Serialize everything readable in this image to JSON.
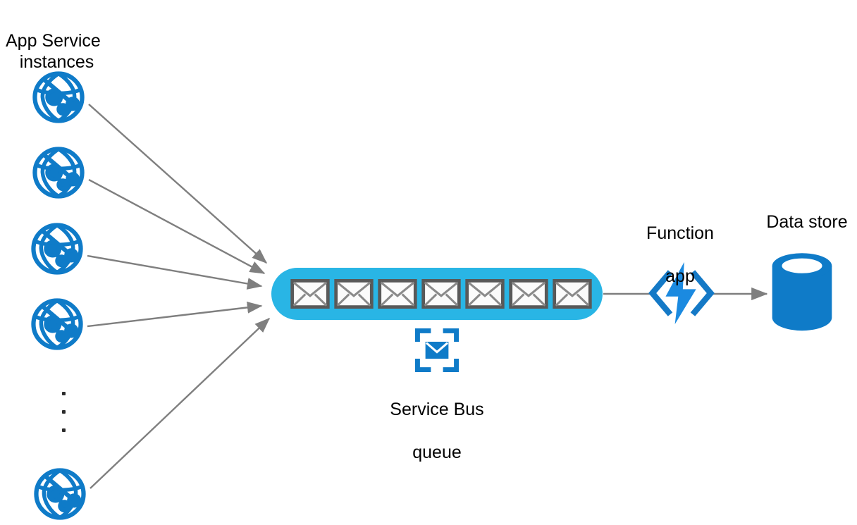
{
  "diagram": {
    "title": "Queue-based load leveling with App Service, Service Bus queue, Function app and Data store",
    "background_color": "#ffffff",
    "colors": {
      "azure_blue": "#0F7BC8",
      "queue_cyan": "#29B5E5",
      "arrow_gray": "#7F7F7F",
      "envelope_border": "#595959",
      "envelope_fill": "#FBFBFB",
      "text_black": "#000000"
    },
    "labels": {
      "app_service": "App Service instances",
      "app_service_line1": "App Service",
      "app_service_line2": "instances",
      "service_bus": "Service Bus queue",
      "service_bus_line1": "Service Bus",
      "service_bus_line2": "queue",
      "function_app": "Function app",
      "function_app_line1": "Function",
      "function_app_line2": "app",
      "data_store": "Data store"
    },
    "nodes": {
      "app_service_instances": {
        "icon": "app-service-globe-icon",
        "count_shown": 5,
        "ellipsis": "⋮",
        "ellipsis_dots": 3,
        "color": "#0F7BC8"
      },
      "service_bus_queue": {
        "icon": "service-bus-queue-icon",
        "queue_fill": "#29B5E5",
        "message_icon": "envelope-icon",
        "message_count": 7
      },
      "function_app": {
        "icon": "azure-function-lightning-icon",
        "color": "#0F7BC8"
      },
      "data_store": {
        "icon": "database-cylinder-icon",
        "color": "#0F7BC8"
      }
    },
    "connections": [
      {
        "from": "app-service-instance-1",
        "to": "service-bus-queue",
        "style": "arrow"
      },
      {
        "from": "app-service-instance-2",
        "to": "service-bus-queue",
        "style": "arrow"
      },
      {
        "from": "app-service-instance-3",
        "to": "service-bus-queue",
        "style": "arrow"
      },
      {
        "from": "app-service-instance-4",
        "to": "service-bus-queue",
        "style": "arrow"
      },
      {
        "from": "app-service-instance-n",
        "to": "service-bus-queue",
        "style": "arrow"
      },
      {
        "from": "service-bus-queue",
        "to": "function-app",
        "style": "line"
      },
      {
        "from": "function-app",
        "to": "data-store",
        "style": "arrow"
      }
    ]
  }
}
